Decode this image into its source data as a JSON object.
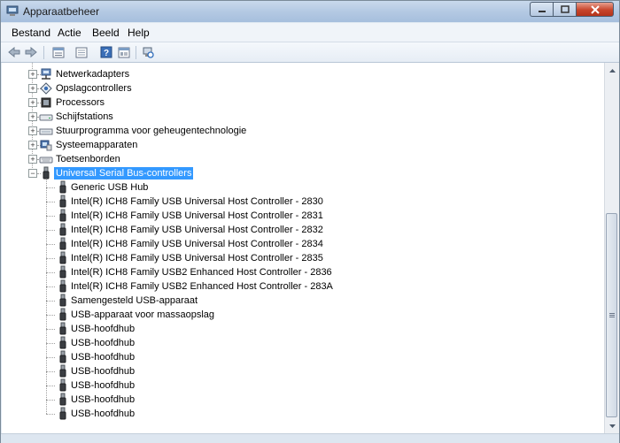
{
  "window": {
    "title": "Apparaatbeheer"
  },
  "menu": [
    "Bestand",
    "Actie",
    "Beeld",
    "Help"
  ],
  "toolbar": {
    "icons": [
      "back-arrow-icon",
      "forward-arrow-icon",
      "properties-list-icon",
      "update-driver-icon",
      "help-icon",
      "details-view-icon",
      "scan-hardware-icon"
    ]
  },
  "tree": {
    "categories_above": [
      {
        "label": "Netwerkadapters",
        "icon": "network-adapter-icon"
      },
      {
        "label": "Opslagcontrollers",
        "icon": "storage-controller-icon"
      },
      {
        "label": "Processors",
        "icon": "processor-icon"
      },
      {
        "label": "Schijfstations",
        "icon": "disk-drive-icon"
      },
      {
        "label": "Stuurprogramma voor geheugentechnologie",
        "icon": "memory-driver-icon"
      },
      {
        "label": "Systeemapparaten",
        "icon": "system-devices-icon"
      },
      {
        "label": "Toetsenborden",
        "icon": "keyboard-icon"
      }
    ],
    "expanded_category": {
      "label": "Universal Serial Bus-controllers",
      "icon": "usb-icon",
      "selected": true
    },
    "devices": [
      "Generic USB Hub",
      "Intel(R) ICH8 Family USB Universal Host Controller - 2830",
      "Intel(R) ICH8 Family USB Universal Host Controller - 2831",
      "Intel(R) ICH8 Family USB Universal Host Controller - 2832",
      "Intel(R) ICH8 Family USB Universal Host Controller - 2834",
      "Intel(R) ICH8 Family USB Universal Host Controller - 2835",
      "Intel(R) ICH8 Family USB2 Enhanced Host Controller - 2836",
      "Intel(R) ICH8 Family USB2 Enhanced Host Controller - 283A",
      "Samengesteld USB-apparaat",
      "USB-apparaat voor massaopslag",
      "USB-hoofdhub",
      "USB-hoofdhub",
      "USB-hoofdhub",
      "USB-hoofdhub",
      "USB-hoofdhub",
      "USB-hoofdhub",
      "USB-hoofdhub"
    ]
  },
  "colors": {
    "selection": "#3399ff",
    "window_frame": "#b4c9e3",
    "close_button": "#c8452b"
  }
}
